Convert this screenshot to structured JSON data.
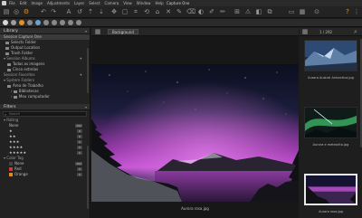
{
  "menu": {
    "items": [
      "File",
      "Edit",
      "Image",
      "Adjustments",
      "Layer",
      "Select",
      "Camera",
      "View",
      "Window",
      "Help"
    ],
    "app_title": "Capture One"
  },
  "viewer": {
    "background_label": "Background",
    "caption": "Aurora rosa.jpg"
  },
  "browser": {
    "counter": "1 / 292",
    "thumbnails": [
      {
        "label": "Aurora Austral Antarctica.jpg"
      },
      {
        "label": "Aurora e meteorito.jpg"
      },
      {
        "label": "Aurora rosa.jpg"
      }
    ]
  },
  "library": {
    "title": "Library",
    "session": "Session Capture One",
    "folders": [
      "Selects Folder",
      "Output Location",
      "Trash Folder"
    ],
    "albums_title": "Session Albums",
    "albums": [
      "Todas as imagens",
      "Cinco estrelas"
    ],
    "favorites_title": "Session Favorites",
    "system_title": "System Folders",
    "system_items": [
      "Área de Trabalho",
      "Bibliotecas",
      "Meu computador"
    ]
  },
  "filters": {
    "title": "Filters",
    "search_placeholder": "Search",
    "rating_title": "Rating",
    "rating_rows": [
      {
        "label": "None",
        "count": "292"
      },
      {
        "label": "★",
        "count": "0"
      },
      {
        "label": "★★",
        "count": "0"
      },
      {
        "label": "★★★",
        "count": "0"
      },
      {
        "label": "★★★★",
        "count": "0"
      },
      {
        "label": "★★★★★",
        "count": "0"
      }
    ],
    "color_title": "Color Tag",
    "color_rows": [
      {
        "label": "None",
        "count": "292",
        "color": "#444444"
      },
      {
        "label": "Red",
        "count": "0",
        "color": "#d23a2a"
      },
      {
        "label": "Orange",
        "count": "0",
        "color": "#e28a1f"
      }
    ]
  },
  "colors": {
    "accent": "#e0912a",
    "panel": "#222222"
  }
}
